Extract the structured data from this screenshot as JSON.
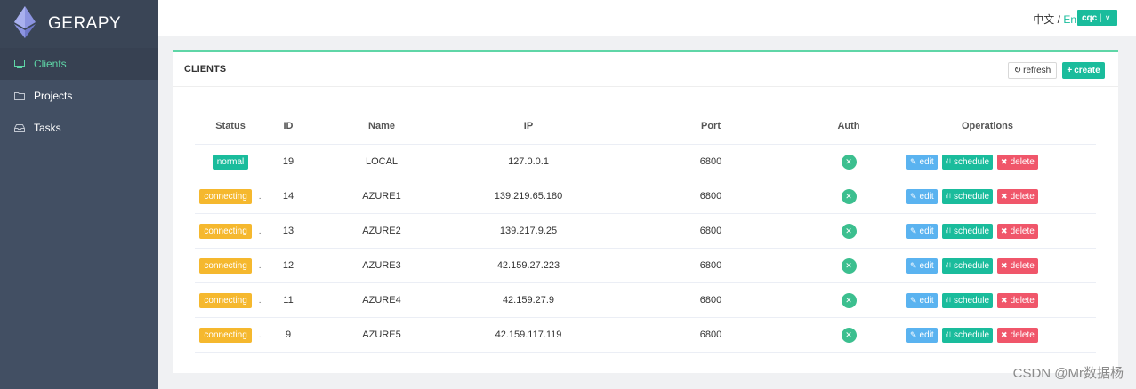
{
  "sidebar": {
    "logo_text": "GERAPY",
    "items": [
      {
        "label": "Clients",
        "icon": "monitor-icon",
        "active": true
      },
      {
        "label": "Projects",
        "icon": "folder-icon",
        "active": false
      },
      {
        "label": "Tasks",
        "icon": "inbox-icon",
        "active": false
      }
    ]
  },
  "header": {
    "lang_zh": "中文",
    "lang_sep": "/",
    "lang_en": "En",
    "user": "cqc"
  },
  "panel": {
    "title": "CLIENTS",
    "refresh_label": "refresh",
    "create_label": "create"
  },
  "table": {
    "columns": [
      "Status",
      "ID",
      "Name",
      "IP",
      "Port",
      "Auth",
      "Operations"
    ],
    "rows": [
      {
        "status": "normal",
        "id": "19",
        "name": "LOCAL",
        "ip": "127.0.0.1",
        "port": "6800"
      },
      {
        "status": "connecting",
        "id": "14",
        "name": "AZURE1",
        "ip": "139.219.65.180",
        "port": "6800"
      },
      {
        "status": "connecting",
        "id": "13",
        "name": "AZURE2",
        "ip": "139.217.9.25",
        "port": "6800"
      },
      {
        "status": "connecting",
        "id": "12",
        "name": "AZURE3",
        "ip": "42.159.27.223",
        "port": "6800"
      },
      {
        "status": "connecting",
        "id": "11",
        "name": "AZURE4",
        "ip": "42.159.27.9",
        "port": "6800"
      },
      {
        "status": "connecting",
        "id": "9",
        "name": "AZURE5",
        "ip": "42.159.117.119",
        "port": "6800"
      }
    ],
    "ops": {
      "edit": "edit",
      "schedule": "schedule",
      "delete": "delete"
    },
    "status_suffix": "."
  },
  "watermark": "CSDN @Mr数据杨",
  "colors": {
    "sidebar_bg": "#424f63",
    "accent": "#1abc9c",
    "connecting": "#f5b82e",
    "edit": "#5ab3f0",
    "delete": "#f0566a"
  }
}
